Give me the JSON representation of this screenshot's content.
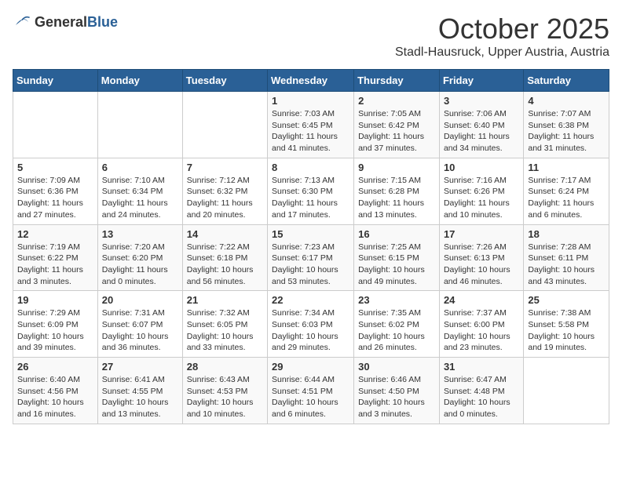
{
  "header": {
    "logo_general": "General",
    "logo_blue": "Blue",
    "month": "October 2025",
    "subtitle": "Stadl-Hausruck, Upper Austria, Austria"
  },
  "weekdays": [
    "Sunday",
    "Monday",
    "Tuesday",
    "Wednesday",
    "Thursday",
    "Friday",
    "Saturday"
  ],
  "weeks": [
    [
      {
        "day": "",
        "info": ""
      },
      {
        "day": "",
        "info": ""
      },
      {
        "day": "",
        "info": ""
      },
      {
        "day": "1",
        "info": "Sunrise: 7:03 AM\nSunset: 6:45 PM\nDaylight: 11 hours and 41 minutes."
      },
      {
        "day": "2",
        "info": "Sunrise: 7:05 AM\nSunset: 6:42 PM\nDaylight: 11 hours and 37 minutes."
      },
      {
        "day": "3",
        "info": "Sunrise: 7:06 AM\nSunset: 6:40 PM\nDaylight: 11 hours and 34 minutes."
      },
      {
        "day": "4",
        "info": "Sunrise: 7:07 AM\nSunset: 6:38 PM\nDaylight: 11 hours and 31 minutes."
      }
    ],
    [
      {
        "day": "5",
        "info": "Sunrise: 7:09 AM\nSunset: 6:36 PM\nDaylight: 11 hours and 27 minutes."
      },
      {
        "day": "6",
        "info": "Sunrise: 7:10 AM\nSunset: 6:34 PM\nDaylight: 11 hours and 24 minutes."
      },
      {
        "day": "7",
        "info": "Sunrise: 7:12 AM\nSunset: 6:32 PM\nDaylight: 11 hours and 20 minutes."
      },
      {
        "day": "8",
        "info": "Sunrise: 7:13 AM\nSunset: 6:30 PM\nDaylight: 11 hours and 17 minutes."
      },
      {
        "day": "9",
        "info": "Sunrise: 7:15 AM\nSunset: 6:28 PM\nDaylight: 11 hours and 13 minutes."
      },
      {
        "day": "10",
        "info": "Sunrise: 7:16 AM\nSunset: 6:26 PM\nDaylight: 11 hours and 10 minutes."
      },
      {
        "day": "11",
        "info": "Sunrise: 7:17 AM\nSunset: 6:24 PM\nDaylight: 11 hours and 6 minutes."
      }
    ],
    [
      {
        "day": "12",
        "info": "Sunrise: 7:19 AM\nSunset: 6:22 PM\nDaylight: 11 hours and 3 minutes."
      },
      {
        "day": "13",
        "info": "Sunrise: 7:20 AM\nSunset: 6:20 PM\nDaylight: 11 hours and 0 minutes."
      },
      {
        "day": "14",
        "info": "Sunrise: 7:22 AM\nSunset: 6:18 PM\nDaylight: 10 hours and 56 minutes."
      },
      {
        "day": "15",
        "info": "Sunrise: 7:23 AM\nSunset: 6:17 PM\nDaylight: 10 hours and 53 minutes."
      },
      {
        "day": "16",
        "info": "Sunrise: 7:25 AM\nSunset: 6:15 PM\nDaylight: 10 hours and 49 minutes."
      },
      {
        "day": "17",
        "info": "Sunrise: 7:26 AM\nSunset: 6:13 PM\nDaylight: 10 hours and 46 minutes."
      },
      {
        "day": "18",
        "info": "Sunrise: 7:28 AM\nSunset: 6:11 PM\nDaylight: 10 hours and 43 minutes."
      }
    ],
    [
      {
        "day": "19",
        "info": "Sunrise: 7:29 AM\nSunset: 6:09 PM\nDaylight: 10 hours and 39 minutes."
      },
      {
        "day": "20",
        "info": "Sunrise: 7:31 AM\nSunset: 6:07 PM\nDaylight: 10 hours and 36 minutes."
      },
      {
        "day": "21",
        "info": "Sunrise: 7:32 AM\nSunset: 6:05 PM\nDaylight: 10 hours and 33 minutes."
      },
      {
        "day": "22",
        "info": "Sunrise: 7:34 AM\nSunset: 6:03 PM\nDaylight: 10 hours and 29 minutes."
      },
      {
        "day": "23",
        "info": "Sunrise: 7:35 AM\nSunset: 6:02 PM\nDaylight: 10 hours and 26 minutes."
      },
      {
        "day": "24",
        "info": "Sunrise: 7:37 AM\nSunset: 6:00 PM\nDaylight: 10 hours and 23 minutes."
      },
      {
        "day": "25",
        "info": "Sunrise: 7:38 AM\nSunset: 5:58 PM\nDaylight: 10 hours and 19 minutes."
      }
    ],
    [
      {
        "day": "26",
        "info": "Sunrise: 6:40 AM\nSunset: 4:56 PM\nDaylight: 10 hours and 16 minutes."
      },
      {
        "day": "27",
        "info": "Sunrise: 6:41 AM\nSunset: 4:55 PM\nDaylight: 10 hours and 13 minutes."
      },
      {
        "day": "28",
        "info": "Sunrise: 6:43 AM\nSunset: 4:53 PM\nDaylight: 10 hours and 10 minutes."
      },
      {
        "day": "29",
        "info": "Sunrise: 6:44 AM\nSunset: 4:51 PM\nDaylight: 10 hours and 6 minutes."
      },
      {
        "day": "30",
        "info": "Sunrise: 6:46 AM\nSunset: 4:50 PM\nDaylight: 10 hours and 3 minutes."
      },
      {
        "day": "31",
        "info": "Sunrise: 6:47 AM\nSunset: 4:48 PM\nDaylight: 10 hours and 0 minutes."
      },
      {
        "day": "",
        "info": ""
      }
    ]
  ]
}
